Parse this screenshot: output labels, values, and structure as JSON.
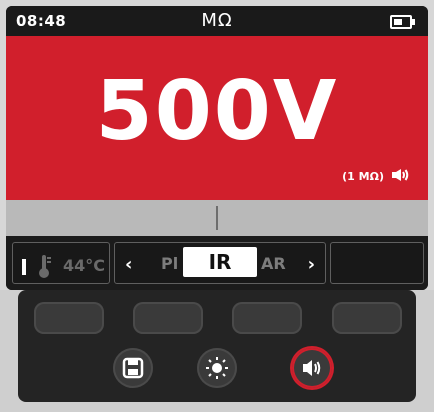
{
  "status": {
    "time": "08:48",
    "unit": "MΩ"
  },
  "display": {
    "voltage": "500V",
    "range": "(1 MΩ)"
  },
  "softkeys": {
    "temp": "44°C",
    "mode_left_ghost": "Pl",
    "mode_selected": "IR",
    "mode_right_ghost": "AR"
  },
  "colors": {
    "main_red": "#d11f2c",
    "status_bg": "#1a1a1a",
    "keypad_bg": "#242424"
  },
  "icons": {
    "battery": "battery-icon",
    "speaker": "speaker-icon",
    "thermometer": "thermometer-icon",
    "save": "save-icon",
    "brightness": "brightness-icon"
  }
}
